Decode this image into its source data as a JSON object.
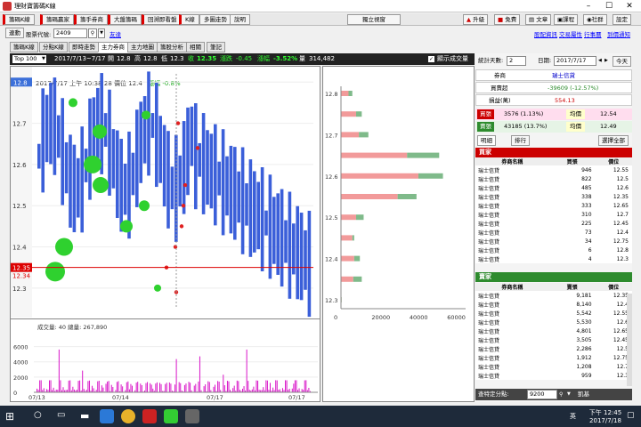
{
  "window": {
    "title": "理財寶籌碼K線"
  },
  "menu_tabs": [
    "籌碼K線",
    "籌碼贏家",
    "籌手券商",
    "大盤籌碼",
    "回溯即看盤",
    "K線",
    "多圖走勢",
    "說明"
  ],
  "menu_buttons": {
    "standalone": "獨立視窗",
    "upgrade": "升級",
    "free": "免費",
    "article": "文章",
    "course": "課程",
    "community": "社群",
    "settings": "設定"
  },
  "stockbar": {
    "sync_label": "連動",
    "code_label": "股票代號:",
    "code_value": "2409",
    "friend_link": "友達"
  },
  "stock_links": [
    "股配資訊",
    "交易屬性",
    "行事曆",
    "到價通知"
  ],
  "sub_tabs": [
    "籌碼K線",
    "分點K線",
    "即時走勢",
    "主力券商",
    "主力地圖",
    "籌股分析",
    "相關",
    "筆記"
  ],
  "active_sub_tab": "主力券商",
  "infobar": {
    "top": "Top 100",
    "date_range": "2017/7/13~7/17",
    "open_label": "開",
    "open": "12.8",
    "high_label": "高",
    "high": "12.8",
    "low_label": "低",
    "low": "12.3",
    "close_label": "收",
    "close": "12.35",
    "change_label": "漲跌",
    "change": "-0.45",
    "pct_label": "漲幅",
    "pct": "-3.52%",
    "vol_label": "量",
    "vol": "314,482",
    "checkbox_label": "顯示成交量"
  },
  "tooltip": {
    "time": "2017/7/17 上午 10:38:28",
    "price_label": "價位",
    "price": "12.4",
    "chg_label": "漲幅",
    "chg": "-0.8%"
  },
  "volume_info": {
    "label_a": "成交量:",
    "val_a": "40",
    "label_b": "總量:",
    "val_b": "267,890"
  },
  "chart_data": [
    {
      "type": "scatter",
      "y": [
        12.3,
        12.35,
        12.4,
        12.45,
        12.5,
        12.55,
        12.6,
        12.65,
        12.7,
        12.75,
        12.8
      ],
      "ylim": [
        12.25,
        12.82
      ],
      "y_ticks": [
        "12.3",
        "12.4",
        "12.5",
        "12.6",
        "12.7",
        "12.8"
      ],
      "x_ticks": [
        "07/13",
        "07/14",
        "07/17",
        "07/17"
      ],
      "price_marker": "12.35",
      "price_marker_2": "12.34"
    },
    {
      "type": "bar",
      "y_ticks": [
        "0",
        "2000",
        "4000",
        "6000"
      ],
      "x_ticks": [
        "07/13",
        "07/14",
        "07/17",
        "07/17"
      ]
    },
    {
      "type": "bar",
      "orientation": "horizontal",
      "categories": [
        "12.8",
        "12.75",
        "12.7",
        "12.65",
        "12.6",
        "12.55",
        "12.5",
        "12.45",
        "12.4",
        "12.35",
        "12.3"
      ],
      "series": [
        {
          "name": "",
          "values": [
            4000,
            8000,
            9500,
            35000,
            41000,
            30000,
            8000,
            6000,
            7000,
            6500,
            300
          ]
        },
        {
          "name": "",
          "values": [
            2000,
            3000,
            5000,
            17000,
            13000,
            10000,
            4000,
            1000,
            3000,
            4500,
            100
          ]
        }
      ],
      "xlim": [
        0,
        66000
      ],
      "x_ticks": [
        "0",
        "20000",
        "40000",
        "60000"
      ]
    }
  ],
  "right": {
    "days_label": "統計天數:",
    "days": "2",
    "date_label": "日期:",
    "date": "2017/7/17",
    "today": "今天",
    "broker_label": "券商",
    "broker": "瑞士信貸",
    "diff_label": "買賣超",
    "diff": "-39609 (-12.57%)",
    "pl_label": "損益(萬)",
    "pl": "554.13",
    "buy_label": "買張",
    "buy": "3576 (1.13%)",
    "avg_label": "均價",
    "buy_avg": "12.54",
    "sell_label": "賣張",
    "sell": "43185 (13.7%)",
    "sell_avg": "12.49",
    "tab_detail": "明細",
    "tab_rank": "排行",
    "select_all": "選擇全部",
    "buyers_title": "買家",
    "col_broker": "券商名稱",
    "col_buy": "買張",
    "col_price": "價位",
    "buyers": [
      [
        "瑞士信貸",
        "946",
        "12.55"
      ],
      [
        "瑞士信貸",
        "822",
        "12.5"
      ],
      [
        "瑞士信貸",
        "485",
        "12.6"
      ],
      [
        "瑞士信貸",
        "338",
        "12.35"
      ],
      [
        "瑞士信貸",
        "333",
        "12.65"
      ],
      [
        "瑞士信貸",
        "310",
        "12.7"
      ],
      [
        "瑞士信貸",
        "225",
        "12.45"
      ],
      [
        "瑞士信貸",
        "73",
        "12.4"
      ],
      [
        "瑞士信貸",
        "34",
        "12.75"
      ],
      [
        "瑞士信貸",
        "6",
        "12.8"
      ],
      [
        "瑞士信貸",
        "4",
        "12.3"
      ]
    ],
    "sellers_title": "賣家",
    "col_sell": "賣張",
    "sellers": [
      [
        "瑞士信貸",
        "9,181",
        "12.35"
      ],
      [
        "瑞士信貸",
        "8,140",
        "12.4"
      ],
      [
        "瑞士信貸",
        "5,542",
        "12.55"
      ],
      [
        "瑞士信貸",
        "5,530",
        "12.6"
      ],
      [
        "瑞士信貸",
        "4,801",
        "12.65"
      ],
      [
        "瑞士信貸",
        "3,505",
        "12.45"
      ],
      [
        "瑞士信貸",
        "2,286",
        "12.5"
      ],
      [
        "瑞士信貸",
        "1,912",
        "12.75"
      ],
      [
        "瑞士信貸",
        "1,208",
        "12.7"
      ],
      [
        "瑞士信貸",
        "959",
        "12.3"
      ]
    ],
    "query_label": "查特定分點:",
    "query_value": "9200",
    "query_name": "凱基"
  },
  "taskbar": {
    "time": "下午 12:45",
    "date": "2017/7/18",
    "lang": "英"
  },
  "colors": {
    "buy_red": "#cc0000",
    "sell_green": "#2e8b2e",
    "bar_pink": "#f29a9a",
    "bar_green": "#7fba8a",
    "candle_blue": "#3b5fd9"
  }
}
